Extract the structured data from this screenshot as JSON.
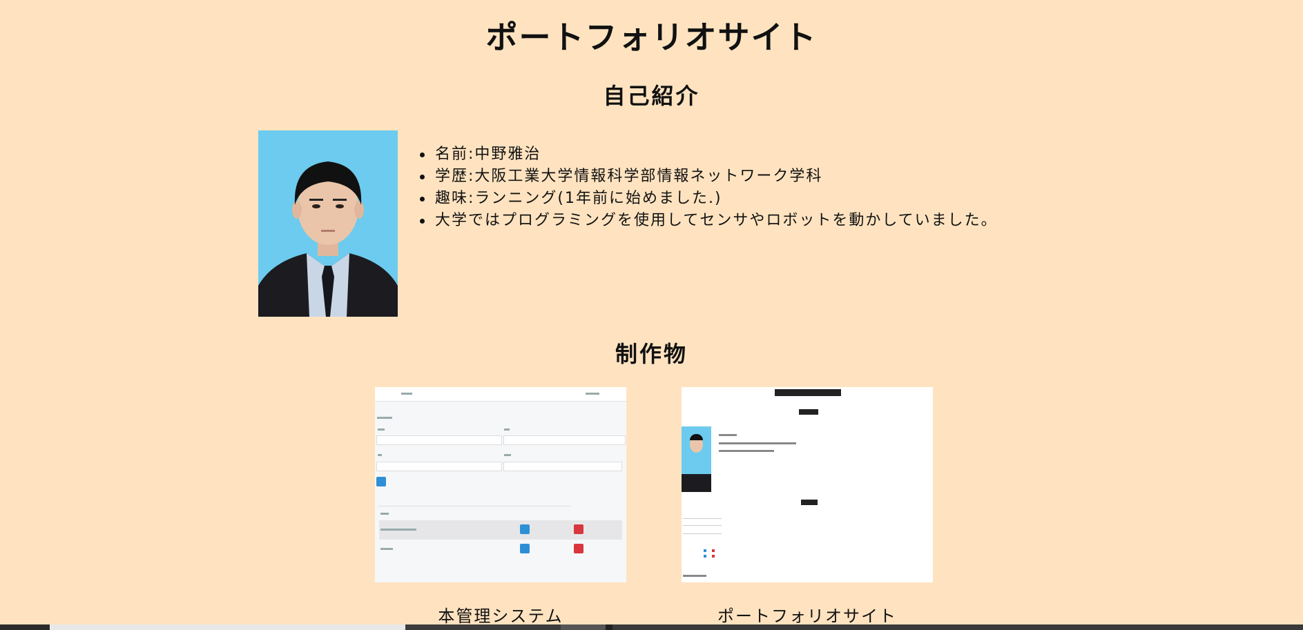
{
  "site_title": "ポートフォリオサイト",
  "about": {
    "title": "自己紹介",
    "photo_icon": "person-portrait-icon",
    "items": [
      "名前:中野雅治",
      "学歴:大阪工業大学情報科学部情報ネットワーク学科",
      "趣味:ランニング(1年前に始めました.)",
      "大学ではプログラミングを使用してセンサやロボットを動かしていました。"
    ]
  },
  "works": {
    "title": "制作物",
    "items": [
      {
        "caption": "本管理システム"
      },
      {
        "caption": "ポートフォリオサイト"
      }
    ]
  },
  "colors": {
    "background": "#ffe3c0",
    "photo_background": "#6ccbee",
    "button_blue": "#2f8fd6",
    "button_red": "#d9363e"
  }
}
